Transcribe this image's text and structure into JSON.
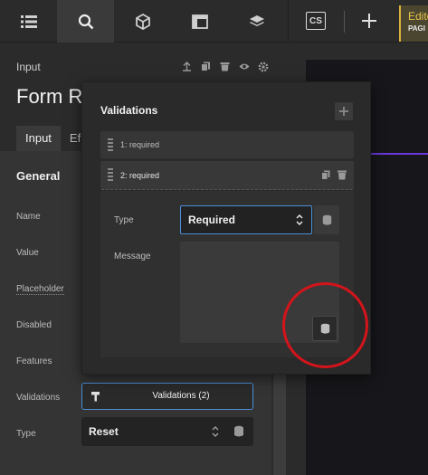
{
  "toolbar": {
    "cs_label": "CS",
    "editor_tab_title": "Edito",
    "editor_tab_sub": "PAGI",
    "accent": "#e8c74a"
  },
  "panel": {
    "kind": "Input",
    "title": "Form R",
    "tabs": [
      "Input",
      "Ef"
    ],
    "section": "General",
    "fields": [
      "Name",
      "Value",
      "Placeholder",
      "Disabled",
      "Features",
      "Validations",
      "Type"
    ],
    "validations_button": "Validations (2)",
    "type_value": "Reset"
  },
  "popup": {
    "title": "Validations",
    "rules": [
      "1: required",
      "2: required"
    ],
    "type_label": "Type",
    "type_value": "Required",
    "message_label": "Message"
  },
  "colors": {
    "focus_blue": "#4b8fd8",
    "canvas_line": "#6a37d8",
    "annotation_red": "#d4141b"
  }
}
